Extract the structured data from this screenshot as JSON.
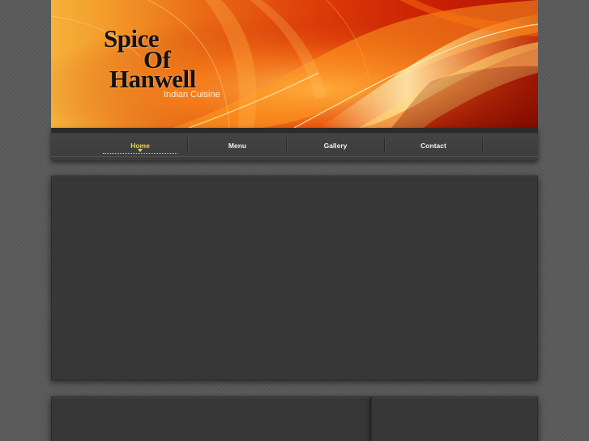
{
  "banner": {
    "logo_line1": "Spice",
    "logo_line2": "Of",
    "logo_line3": "Hanwell",
    "tagline": "Indian Cuisine"
  },
  "nav": {
    "items": [
      {
        "label": "Home",
        "active": true
      },
      {
        "label": "Menu",
        "active": false
      },
      {
        "label": "Gallery",
        "active": false
      },
      {
        "label": "Contact",
        "active": false
      }
    ]
  },
  "colors": {
    "page_background": "#5a5a5a",
    "panel_background": "#373737",
    "nav_active": "#e8d64a",
    "nav_text": "#f0f0f0",
    "banner_orange": "#ea6d16",
    "banner_red": "#c81e04"
  }
}
